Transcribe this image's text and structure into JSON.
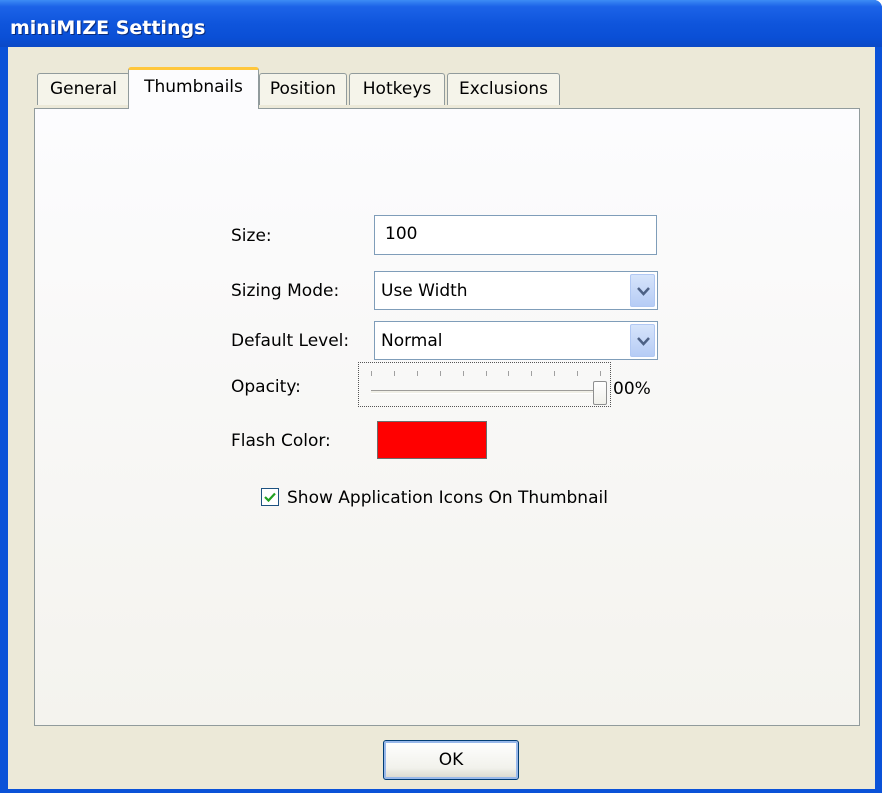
{
  "window": {
    "title": "miniMIZE Settings"
  },
  "tabs": [
    {
      "label": "General",
      "active": false
    },
    {
      "label": "Thumbnails",
      "active": true
    },
    {
      "label": "Position",
      "active": false
    },
    {
      "label": "Hotkeys",
      "active": false
    },
    {
      "label": "Exclusions",
      "active": false
    }
  ],
  "thumbnails": {
    "size": {
      "label": "Size:",
      "value": "100"
    },
    "sizing_mode": {
      "label": "Sizing Mode:",
      "value": "Use Width"
    },
    "default_level": {
      "label": "Default Level:",
      "value": "Normal"
    },
    "opacity": {
      "label": "Opacity:",
      "value_text": "00%",
      "level": 1.0,
      "tick_count": 11
    },
    "flash_color": {
      "label": "Flash Color:",
      "color": "#ff0000"
    },
    "show_icons": {
      "label": "Show Application Icons On Thumbnail",
      "checked": true
    }
  },
  "buttons": {
    "ok": "OK"
  },
  "icons": {
    "combo_arrow": "chevron-down-icon",
    "check": "checkmark-icon"
  }
}
